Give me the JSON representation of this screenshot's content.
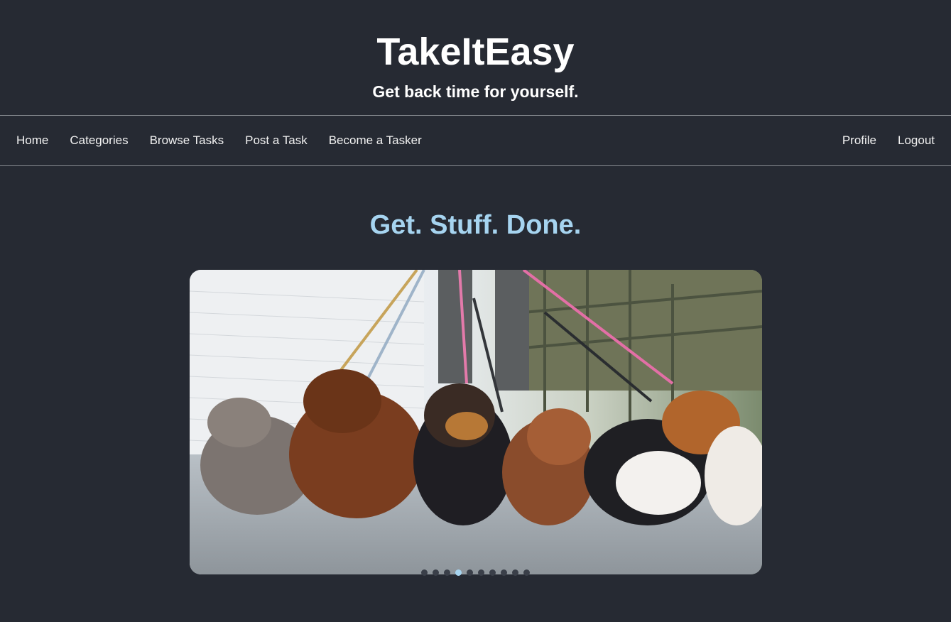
{
  "header": {
    "title": "TakeItEasy",
    "tagline": "Get back time for yourself."
  },
  "nav": {
    "left": [
      {
        "label": "Home"
      },
      {
        "label": "Categories"
      },
      {
        "label": "Browse Tasks"
      },
      {
        "label": "Post a Task"
      },
      {
        "label": "Become a Tasker"
      }
    ],
    "right": [
      {
        "label": "Profile"
      },
      {
        "label": "Logout"
      }
    ]
  },
  "hero": {
    "heading": "Get. Stuff. Done."
  },
  "carousel": {
    "slide_count": 10,
    "active_index": 3
  },
  "colors": {
    "background": "#262a33",
    "accent": "#a6d4f0",
    "text": "#ffffff"
  }
}
